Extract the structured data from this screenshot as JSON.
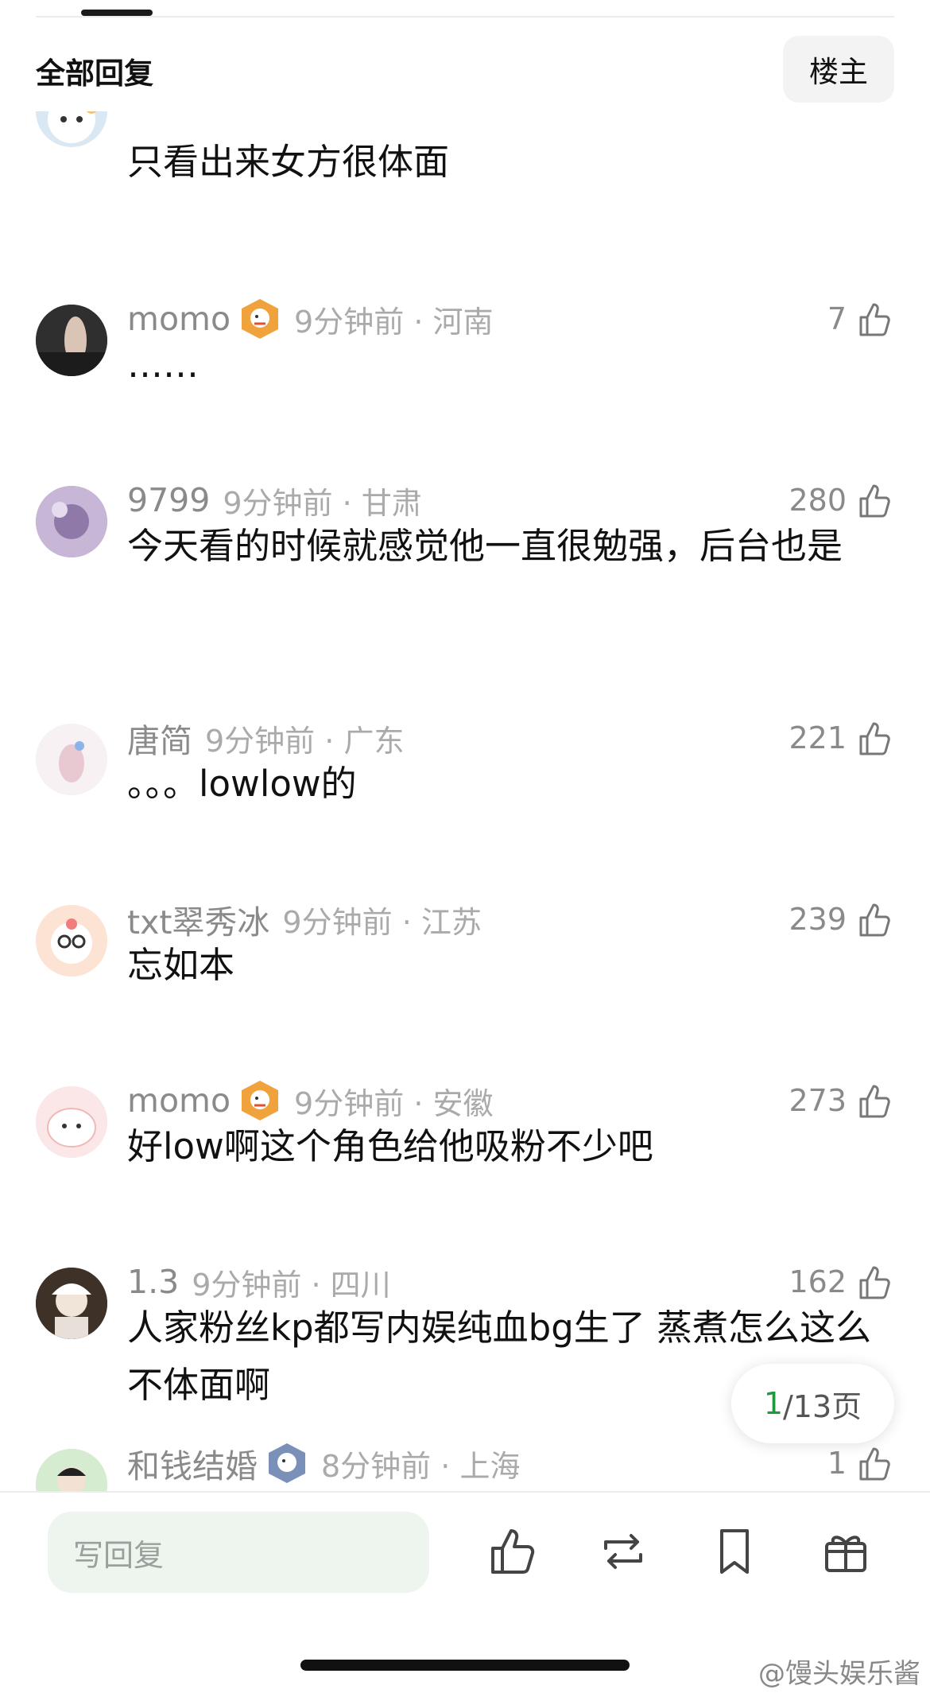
{
  "header": {
    "title": "全部回复",
    "owner_button": "楼主"
  },
  "comments": [
    {
      "name": "",
      "time": "",
      "location": "",
      "likes": "",
      "text": "只看出来女方很体面"
    },
    {
      "name": "momo",
      "time": "9分钟前",
      "location": "河南",
      "likes": "7",
      "text": "……"
    },
    {
      "name": "9799",
      "time": "9分钟前",
      "location": "甘肃",
      "likes": "280",
      "text": "今天看的时候就感觉他一直很勉强，后台也是"
    },
    {
      "name": "唐简",
      "time": "9分钟前",
      "location": "广东",
      "likes": "221",
      "text": "。。。lowlow的"
    },
    {
      "name": "txt翠秀冰",
      "time": "9分钟前",
      "location": "江苏",
      "likes": "239",
      "text": "忘如本"
    },
    {
      "name": "momo",
      "time": "9分钟前",
      "location": "安徽",
      "likes": "273",
      "text": "好low啊这个角色给他吸粉不少吧"
    },
    {
      "name": "1.3",
      "time": "9分钟前",
      "location": "四川",
      "likes": "162",
      "text": "人家粉丝kp都写内娱纯血bg生了 蒸煮怎么这么不体面啊"
    },
    {
      "name": "和钱结婚",
      "time": "8分钟前",
      "location": "上海",
      "likes": "1",
      "text": ""
    }
  ],
  "pagination": {
    "current": "1",
    "total_label": "/13页"
  },
  "bottom_bar": {
    "reply_placeholder": "写回复"
  },
  "watermark": "@馒头娱乐酱",
  "icons": {
    "like": "thumbs-up-icon",
    "repost": "repost-icon",
    "bookmark": "bookmark-icon",
    "gift": "gift-icon",
    "badge": "fox-badge-icon"
  }
}
